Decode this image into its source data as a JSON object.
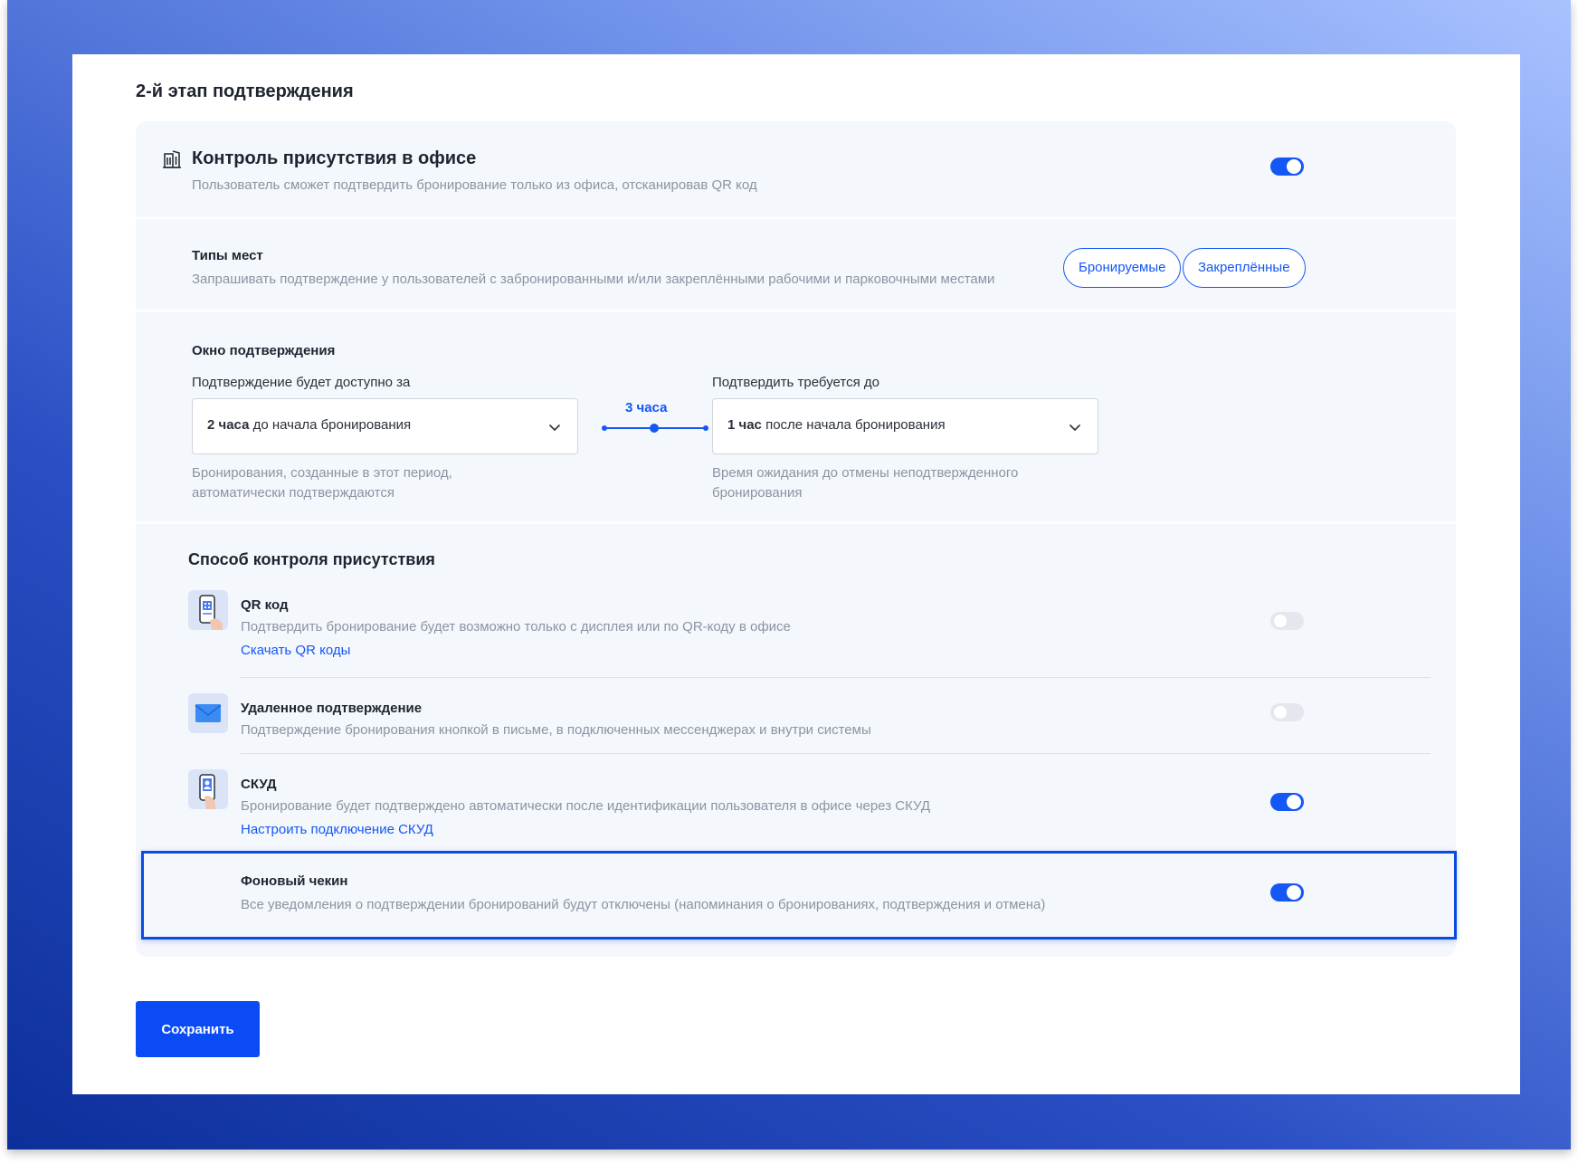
{
  "section_title": "2-й этап подтверждения",
  "presence": {
    "title": "Контроль присутствия в офисе",
    "subtitle": "Пользователь сможет подтвердить бронирование только из офиса, отсканировав QR код",
    "enabled": true
  },
  "place_types": {
    "title": "Типы мест",
    "subtitle": "Запрашивать подтверждение у пользователей с забронированными и/или закреплёнными рабочими и парковочными местами",
    "options": [
      "Бронируемые",
      "Закреплённые"
    ]
  },
  "window": {
    "title": "Окно подтверждения",
    "start": {
      "label": "Подтверждение будет доступно за",
      "value_bold": "2 часа",
      "value_rest": " до начала бронирования",
      "help": "Бронирования, созданные в этот период, автоматически подтверждаются"
    },
    "span_label": "3 часа",
    "end": {
      "label": "Подтвердить требуется до",
      "value_bold": "1 час",
      "value_rest": " после начала бронирования",
      "help": "Время ожидания до отмены неподтвержденного бронирования"
    }
  },
  "methods": {
    "title": "Способ контроля присутствия",
    "items": [
      {
        "icon": "qr-phone-icon",
        "title": "QR код",
        "subtitle": "Подтвердить бронирование будет возможно только с дисплея или по QR-коду в офисе",
        "link": "Скачать QR коды",
        "enabled": false
      },
      {
        "icon": "envelope-icon",
        "title": "Удаленное подтверждение",
        "subtitle": "Подтверждение бронирования кнопкой в письме, в подключенных мессенджерах и внутри системы",
        "enabled": false
      },
      {
        "icon": "access-card-icon",
        "title": "СКУД",
        "subtitle": "Бронирование будет подтверждено автоматически после идентификации пользователя в офисе через СКУД",
        "link": "Настроить подключение СКУД",
        "enabled": true
      },
      {
        "title": "Фоновый чекин",
        "subtitle": "Все уведомления о подтверждении бронирований будут отключены (напоминания о бронированиях, подтверждения и отмена)",
        "enabled": true
      }
    ]
  },
  "save_label": "Сохранить",
  "colors": {
    "accent": "#1457f5",
    "card_bg": "#f4f7fc",
    "muted_text": "#8d93a1",
    "highlight_border": "#0a4be0"
  }
}
